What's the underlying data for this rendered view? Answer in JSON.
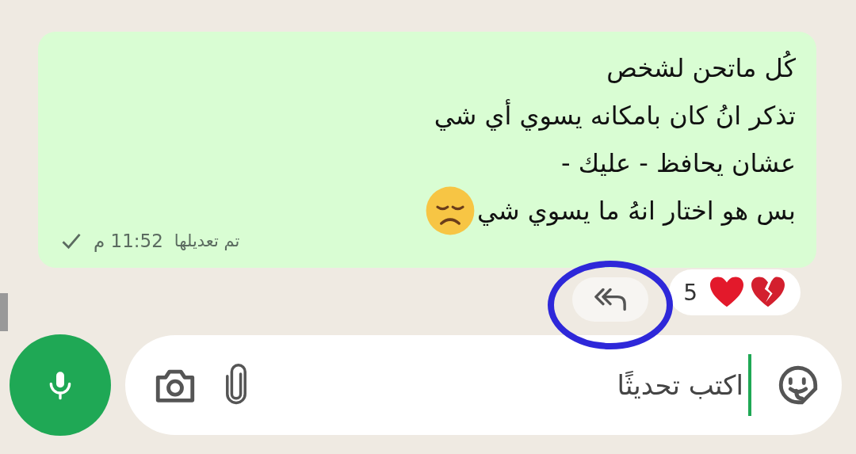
{
  "message": {
    "lines": [
      "كُل ماتحن لشخص",
      "تذكر انُ كان بامكانه يسوي أي شي",
      "عشان يحافظ - عليك -",
      "بس هو اختار  انهُ ما يسوي شي"
    ],
    "edited_label": "تم تعديلها",
    "time": "11:52 م",
    "read": false
  },
  "reactions": {
    "count": "5"
  },
  "composer": {
    "placeholder": "اكتب تحديثًا"
  }
}
